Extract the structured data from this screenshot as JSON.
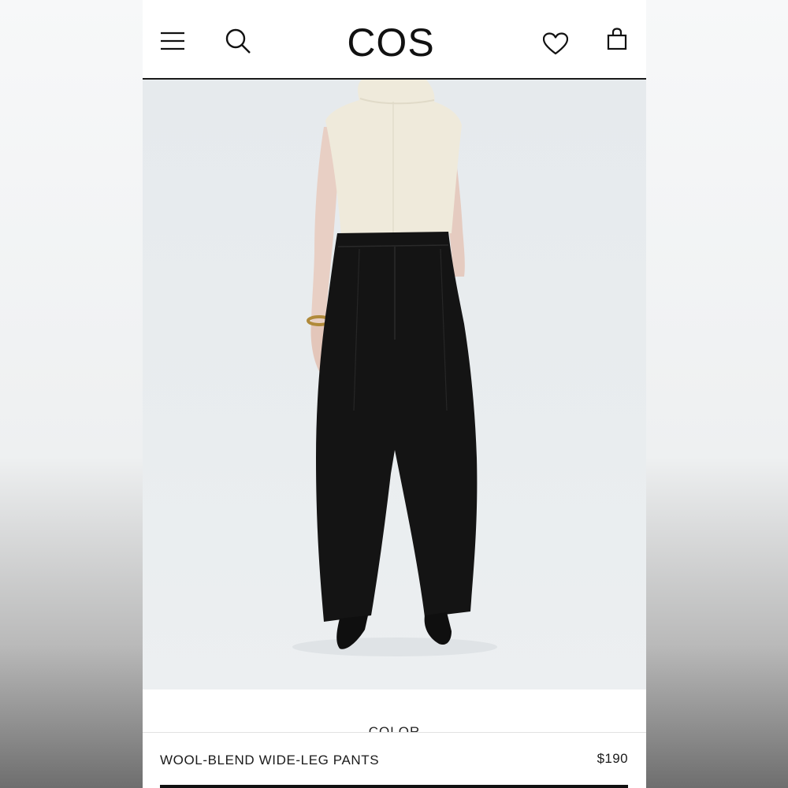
{
  "header": {
    "logo": "COS",
    "icons": [
      "menu-icon",
      "search-icon",
      "heart-icon",
      "bag-icon"
    ]
  },
  "product": {
    "name": "WOOL-BLEND WIDE-LEG PANTS",
    "price": "$190",
    "color_label": "COLOR"
  },
  "colors": {
    "text": "#1a1a1a",
    "image_bg": "#e8ecee",
    "pants": "#141414",
    "top": "#efeadb"
  }
}
